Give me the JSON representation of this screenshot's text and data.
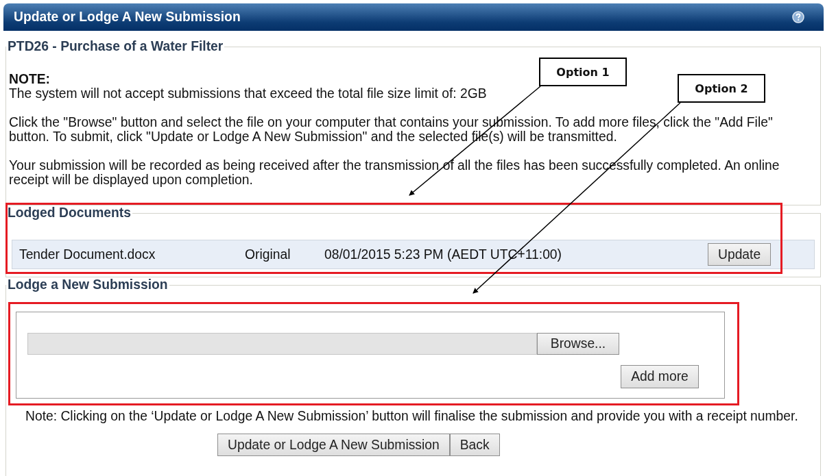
{
  "header": {
    "title": "Update or Lodge A New Submission"
  },
  "details": {
    "legend": "PTD26 - Purchase of a Water Filter",
    "note_heading": "NOTE:",
    "paragraphs": [
      "The system will not accept submissions that exceed the total file size limit of: 2GB",
      "Click the \"Browse\" button and select the file on your computer that contains your submission. To add more files, click the \"Add File\" button. To submit, click \"Update or Lodge A New Submission\" and the selected file(s) will be transmitted.",
      "Your submission will be recorded as being received after the transmission of all the files has been successfully completed. An online receipt will be displayed upon completion."
    ]
  },
  "lodged": {
    "legend": "Lodged Documents",
    "rows": [
      {
        "file": "Tender Document.docx",
        "type": "Original",
        "date": "08/01/2015 5:23 PM (AEDT UTC+11:00)",
        "button": "Update"
      }
    ]
  },
  "new_submission": {
    "legend": "Lodge a New Submission",
    "file_button": "Browse...",
    "add_button": "Add more",
    "note": "Note: Clicking on the ‘Update or Lodge A New Submission’ button will finalise the submission and provide you with a receipt number.",
    "buttons": [
      "Update or Lodge A New Submission",
      "Back"
    ]
  },
  "callouts": [
    {
      "label": "Option 1"
    },
    {
      "label": "Option 2"
    }
  ]
}
